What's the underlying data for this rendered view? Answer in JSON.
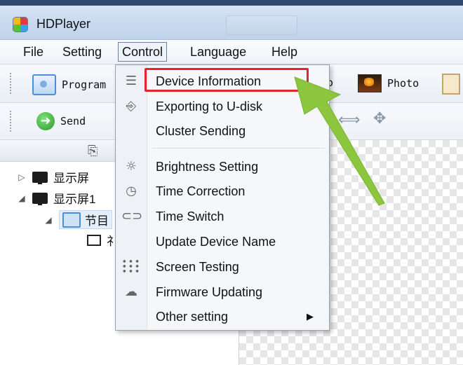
{
  "window": {
    "title": "HDPlayer"
  },
  "menubar": {
    "items": [
      "File",
      "Setting",
      "Control",
      "Language",
      "Help"
    ]
  },
  "toolbar": {
    "program_label": "Program",
    "photo_label": "Photo",
    "partial_label": "o"
  },
  "toolbar2": {
    "send_label": "Send"
  },
  "tree": {
    "items": [
      {
        "label": "显示屏",
        "expanded": false
      },
      {
        "label": "显示屏1",
        "expanded": true
      },
      {
        "label": "节目",
        "expanded": true
      },
      {
        "label": "礻"
      }
    ]
  },
  "control_menu": {
    "items": [
      {
        "label": "Device Information",
        "icon": "list-icon",
        "highlighted": true
      },
      {
        "label": "Exporting to U-disk",
        "icon": "usb-icon"
      },
      {
        "label": "Cluster Sending",
        "icon": ""
      },
      {
        "label": "Brightness Setting",
        "icon": "bulb-icon"
      },
      {
        "label": "Time Correction",
        "icon": "clock-icon"
      },
      {
        "label": "Time Switch",
        "icon": "toggle-icon"
      },
      {
        "label": "Update Device Name",
        "icon": ""
      },
      {
        "label": "Screen Testing",
        "icon": "grid-dots-icon"
      },
      {
        "label": "Firmware Updating",
        "icon": "cloud-icon"
      },
      {
        "label": "Other setting",
        "icon": "",
        "submenu": true
      }
    ]
  },
  "colors": {
    "highlight_border": "#e3262e",
    "pointer_arrow": "#8cc63f"
  }
}
